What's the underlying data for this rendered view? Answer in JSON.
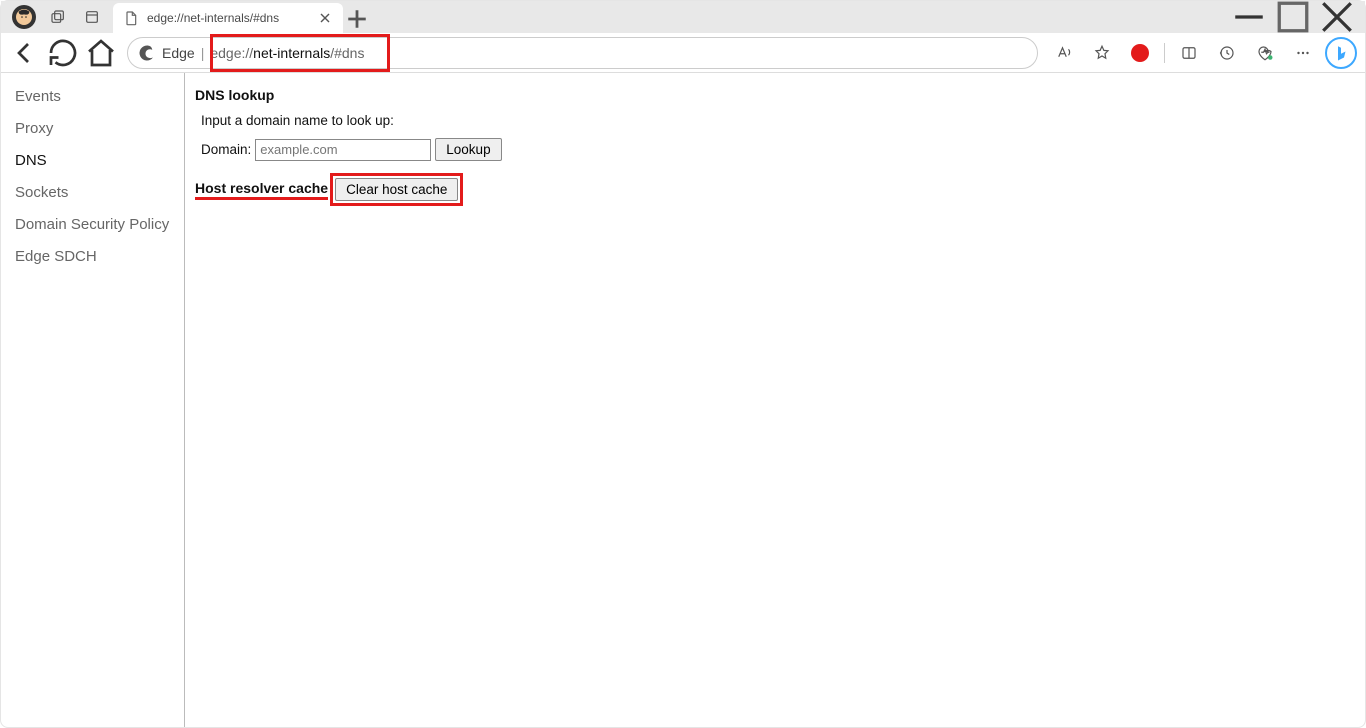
{
  "tab": {
    "title": "edge://net-internals/#dns"
  },
  "addressbar": {
    "engine_label": "Edge",
    "url_muted_prefix": "edge://",
    "url_strong": "net-internals",
    "url_muted_suffix": "/#dns"
  },
  "sidebar": {
    "items": [
      {
        "label": "Events",
        "active": false
      },
      {
        "label": "Proxy",
        "active": false
      },
      {
        "label": "DNS",
        "active": true
      },
      {
        "label": "Sockets",
        "active": false
      },
      {
        "label": "Domain Security Policy",
        "active": false
      },
      {
        "label": "Edge SDCH",
        "active": false
      }
    ]
  },
  "main": {
    "dns_lookup_title": "DNS lookup",
    "instructions": "Input a domain name to look up:",
    "domain_label": "Domain:",
    "domain_placeholder": "example.com",
    "lookup_btn": "Lookup",
    "cache_label": "Host resolver cache",
    "clear_btn": "Clear host cache"
  }
}
